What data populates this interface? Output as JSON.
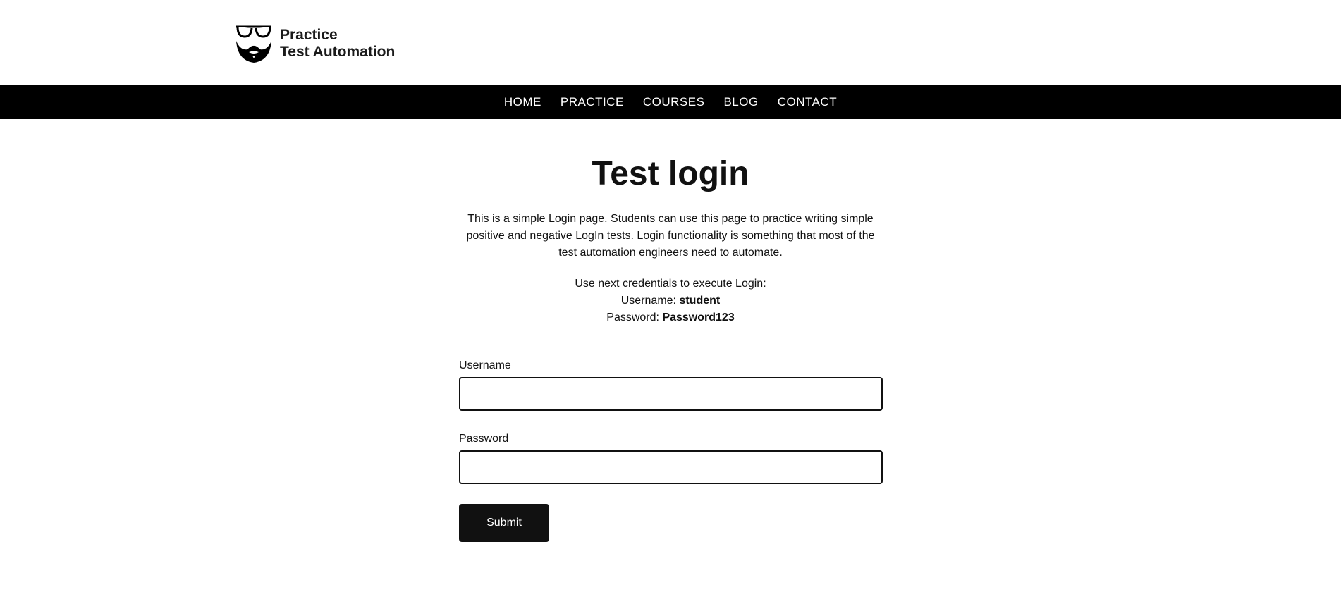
{
  "header": {
    "logo_line1": "Practice",
    "logo_line2": "Test Automation",
    "logo_icon": "glasses-beard-icon"
  },
  "nav": {
    "items": [
      {
        "label": "HOME"
      },
      {
        "label": "PRACTICE"
      },
      {
        "label": "COURSES"
      },
      {
        "label": "BLOG"
      },
      {
        "label": "CONTACT"
      }
    ]
  },
  "main": {
    "title": "Test login",
    "description": "This is a simple Login page. Students can use this page to practice writing simple positive and negative LogIn tests. Login functionality is something that most of the test automation engineers need to automate.",
    "credentials_intro": "Use next credentials to execute Login:",
    "username_label": "Username:",
    "username_value": "student",
    "password_label": "Password:",
    "password_value": "Password123"
  },
  "form": {
    "username_label": "Username",
    "username_value": "",
    "password_label": "Password",
    "password_value": "",
    "submit_label": "Submit"
  },
  "colors": {
    "nav_background": "#000000",
    "button_background": "#111111",
    "text": "#111111"
  }
}
